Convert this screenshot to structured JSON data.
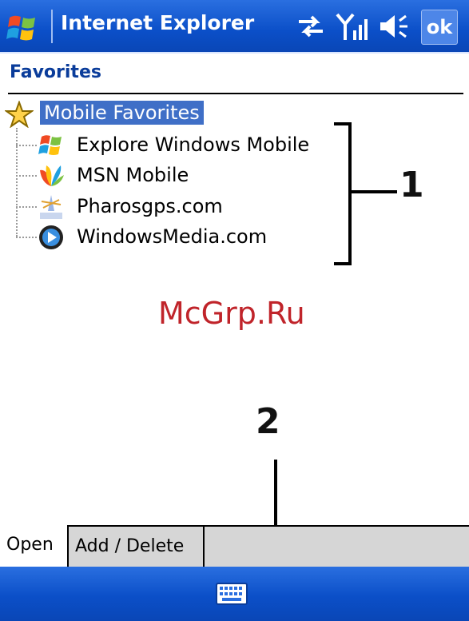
{
  "titlebar": {
    "title": "Internet Explorer",
    "ok_label": "ok",
    "icons": [
      "windows-flag-icon",
      "connectivity-icon",
      "signal-icon",
      "speaker-icon"
    ]
  },
  "pane": {
    "title": "Favorites"
  },
  "tree": {
    "root_label": "Mobile Favorites",
    "items": [
      {
        "label": "Explore Windows Mobile",
        "icon": "windows-flag-icon"
      },
      {
        "label": "MSN Mobile",
        "icon": "msn-butterfly-icon"
      },
      {
        "label": "Pharosgps.com",
        "icon": "pharos-icon"
      },
      {
        "label": "WindowsMedia.com",
        "icon": "windows-media-icon"
      }
    ]
  },
  "annotations": {
    "label_1": "1",
    "label_2": "2",
    "watermark": "McGrp.Ru"
  },
  "tabs": [
    {
      "label": "Open",
      "active": true
    },
    {
      "label": "Add / Delete",
      "active": false
    }
  ],
  "menubar": {
    "icon": "keyboard-icon"
  },
  "colors": {
    "title_bg": "#0b4fc8",
    "selection": "#3f6fc7",
    "watermark": "#c0242a"
  }
}
